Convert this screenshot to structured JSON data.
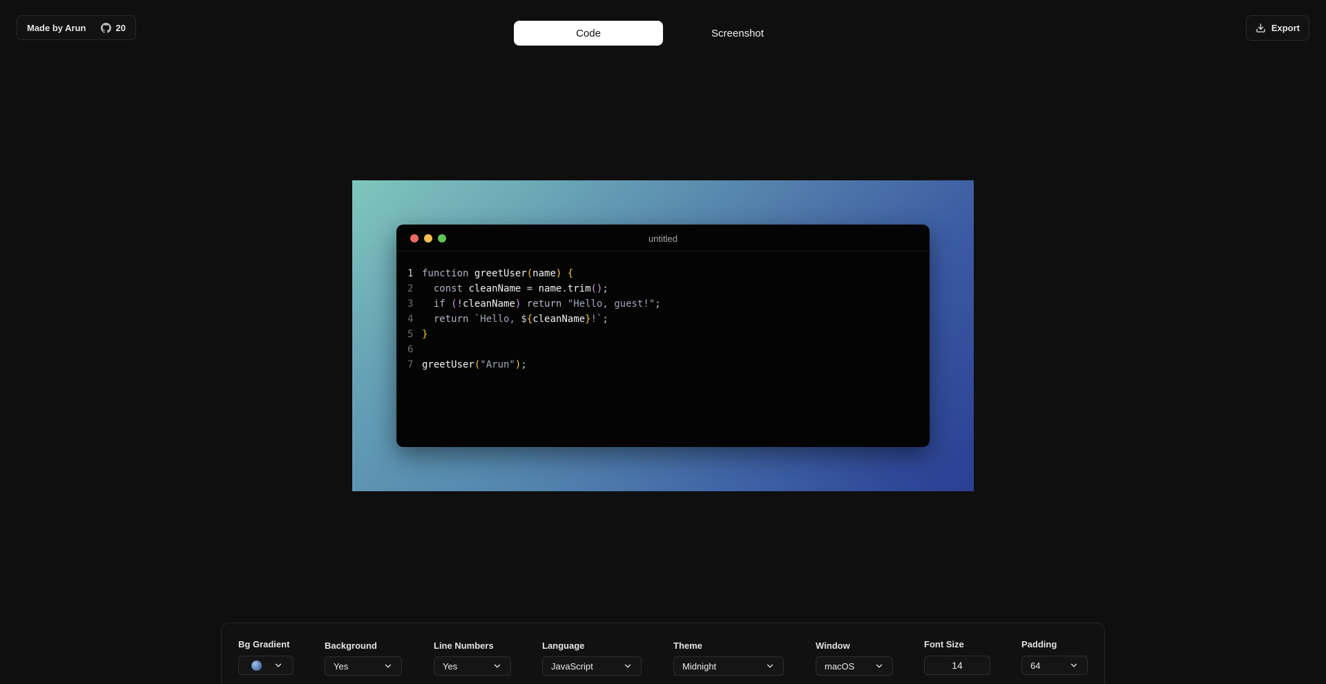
{
  "header": {
    "made_by": "Made by Arun",
    "github_stars": "20",
    "tabs": [
      {
        "label": "Code",
        "active": true
      },
      {
        "label": "Screenshot",
        "active": false
      }
    ],
    "export_label": "Export"
  },
  "window": {
    "title": "untitled",
    "language": "JavaScript"
  },
  "code_lines": [
    "function greetUser(name) {",
    "  const cleanName = name.trim();",
    "  if (!cleanName) return \"Hello, guest!\";",
    "  return `Hello, ${cleanName}!`;",
    "}",
    "",
    "greetUser(\"Arun\");"
  ],
  "line_numbers": [
    "1",
    "2",
    "3",
    "4",
    "5",
    "6",
    "7"
  ],
  "controls": {
    "bg_gradient": {
      "label": "Bg Gradient"
    },
    "background": {
      "label": "Background",
      "value": "Yes"
    },
    "line_numbers": {
      "label": "Line Numbers",
      "value": "Yes"
    },
    "language": {
      "label": "Language",
      "value": "JavaScript"
    },
    "theme": {
      "label": "Theme",
      "value": "Midnight"
    },
    "window": {
      "label": "Window",
      "value": "macOS"
    },
    "font_size": {
      "label": "Font Size",
      "value": "14"
    },
    "padding": {
      "label": "Padding",
      "value": "64"
    }
  },
  "colors": {
    "page_bg": "#0f0f0f",
    "gradient_start": "#7fc6bc",
    "gradient_end": "#2a3f93",
    "dot_red": "#ed6a5e",
    "dot_yellow": "#f5bf4f",
    "dot_green": "#61c554"
  },
  "icons": {
    "github": "github-icon",
    "export": "download-icon",
    "chevron": "chevron-down-icon"
  }
}
